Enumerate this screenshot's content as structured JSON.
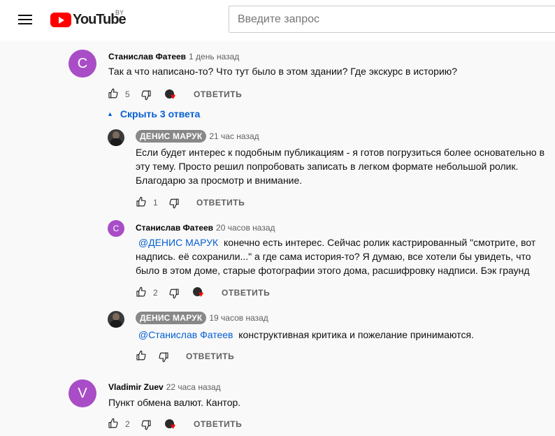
{
  "header": {
    "logo_text": "YouTube",
    "region": "BY",
    "search_placeholder": "Введите запрос"
  },
  "colors": {
    "brand_red": "#ff0000",
    "link_blue": "#065fd4",
    "avatar_purple": "#a94dc7",
    "owner_badge": "#888888",
    "heart_red": "#ff0000"
  },
  "actions": {
    "reply_label": "ОТВЕТИТЬ"
  },
  "comments": [
    {
      "avatar_letter": "С",
      "author": "Станислав Фатеев",
      "time": "1 день назад",
      "text": "Так а что написано-то? Что тут было в этом здании? Где экскурс в историю?",
      "likes": "5",
      "hearted": true,
      "toggle_label": "Скрыть 3 ответа",
      "replies": [
        {
          "author": "ДЕНИС МАРУК",
          "time": "21 час назад",
          "text": "Если будет интерес к подобным публикациям - я готов погрузиться более основательно в эту тему. Просто решил попробовать записать в легком формате небольшой ролик. Благодарю за просмотр и внимание.",
          "likes": "1"
        },
        {
          "avatar_letter": "С",
          "author": "Станислав Фатеев",
          "time": "20 часов назад",
          "mention": "@ДЕНИС МАРУК",
          "text": "конечно есть интерес. Сейчас ролик кастрированный \"смотрите, вот надпись. её сохранили...\" а где сама история-то? Я думаю, все хотели бы увидеть, что было в этом доме, старые фотографии этого дома, расшифровку надписи. Бэк граунд",
          "likes": "2",
          "hearted": true
        },
        {
          "author": "ДЕНИС МАРУК",
          "time": "19 часов назад",
          "mention": "@Станислав Фатеев",
          "text": "конструктивная критика и пожелание принимаются."
        }
      ]
    },
    {
      "avatar_letter": "V",
      "author": "Vladimir Zuev",
      "time": "22 часа назад",
      "text": "Пункт обмена валют. Кантор.",
      "likes": "2",
      "hearted": true
    }
  ]
}
